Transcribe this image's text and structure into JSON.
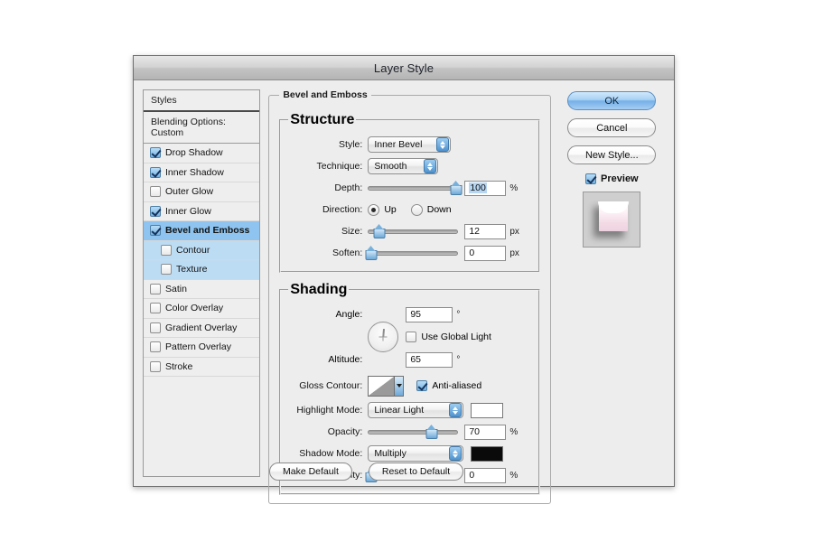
{
  "dialog": {
    "title": "Layer Style"
  },
  "sidebar": {
    "header": "Styles",
    "blending": "Blending Options: Custom",
    "items": [
      {
        "label": "Drop Shadow",
        "checked": true,
        "sub": false,
        "state": "normal"
      },
      {
        "label": "Inner Shadow",
        "checked": true,
        "sub": false,
        "state": "normal"
      },
      {
        "label": "Outer Glow",
        "checked": false,
        "sub": false,
        "state": "normal"
      },
      {
        "label": "Inner Glow",
        "checked": true,
        "sub": false,
        "state": "normal"
      },
      {
        "label": "Bevel and Emboss",
        "checked": true,
        "sub": false,
        "state": "selected"
      },
      {
        "label": "Contour",
        "checked": false,
        "sub": true,
        "state": "childsel"
      },
      {
        "label": "Texture",
        "checked": false,
        "sub": true,
        "state": "childsel"
      },
      {
        "label": "Satin",
        "checked": false,
        "sub": false,
        "state": "normal"
      },
      {
        "label": "Color Overlay",
        "checked": false,
        "sub": false,
        "state": "normal"
      },
      {
        "label": "Gradient Overlay",
        "checked": false,
        "sub": false,
        "state": "normal"
      },
      {
        "label": "Pattern Overlay",
        "checked": false,
        "sub": false,
        "state": "normal"
      },
      {
        "label": "Stroke",
        "checked": false,
        "sub": false,
        "state": "normal"
      }
    ]
  },
  "main": {
    "group_title": "Bevel and Emboss",
    "structure": {
      "title": "Structure",
      "style_label": "Style:",
      "style_value": "Inner Bevel",
      "technique_label": "Technique:",
      "technique_value": "Smooth",
      "depth_label": "Depth:",
      "depth_value": "100",
      "depth_unit": "%",
      "depth_percent": 100,
      "direction_label": "Direction:",
      "direction_up": "Up",
      "direction_down": "Down",
      "direction_selected": "Up",
      "size_label": "Size:",
      "size_value": "12",
      "size_unit": "px",
      "size_percent": 12,
      "soften_label": "Soften:",
      "soften_value": "0",
      "soften_unit": "px",
      "soften_percent": 0
    },
    "shading": {
      "title": "Shading",
      "angle_label": "Angle:",
      "angle_value": "95",
      "angle_unit": "°",
      "global_light_label": "Use Global Light",
      "global_light_checked": false,
      "altitude_label": "Altitude:",
      "altitude_value": "65",
      "altitude_unit": "°",
      "gloss_contour_label": "Gloss Contour:",
      "anti_aliased_label": "Anti-aliased",
      "anti_aliased_checked": true,
      "highlight_mode_label": "Highlight Mode:",
      "highlight_mode_value": "Linear Light",
      "highlight_color": "#ffffff",
      "highlight_opacity_label": "Opacity:",
      "highlight_opacity_value": "70",
      "highlight_opacity_unit": "%",
      "highlight_opacity_percent": 70,
      "shadow_mode_label": "Shadow Mode:",
      "shadow_mode_value": "Multiply",
      "shadow_color": "#0a0a0a",
      "shadow_opacity_label": "Opacity:",
      "shadow_opacity_value": "0",
      "shadow_opacity_unit": "%",
      "shadow_opacity_percent": 0
    }
  },
  "right": {
    "ok": "OK",
    "cancel": "Cancel",
    "new_style": "New Style...",
    "preview_label": "Preview",
    "preview_checked": true
  },
  "footer": {
    "make_default": "Make Default",
    "reset_to_default": "Reset to Default"
  }
}
